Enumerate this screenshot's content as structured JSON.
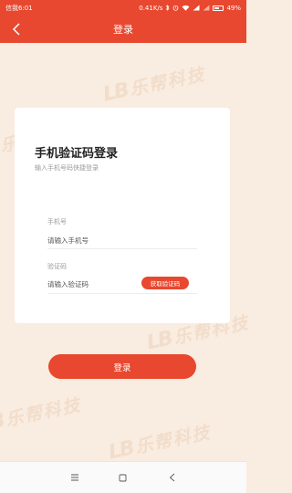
{
  "status_bar": {
    "carrier": "信我6:01",
    "network_speed": "0.41K/s",
    "battery": "49%"
  },
  "header": {
    "title": "登录"
  },
  "watermark": {
    "text": "乐帮科技"
  },
  "card": {
    "title": "手机验证码登录",
    "subtitle": "输入手机号码快捷登录",
    "phone": {
      "label": "手机号",
      "placeholder": "请输入手机号"
    },
    "code": {
      "label": "验证码",
      "placeholder": "请输入验证码",
      "button_label": "获取验证码"
    }
  },
  "login_button_label": "登录",
  "colors": {
    "accent": "#e8482f",
    "background": "#f9ece0"
  }
}
